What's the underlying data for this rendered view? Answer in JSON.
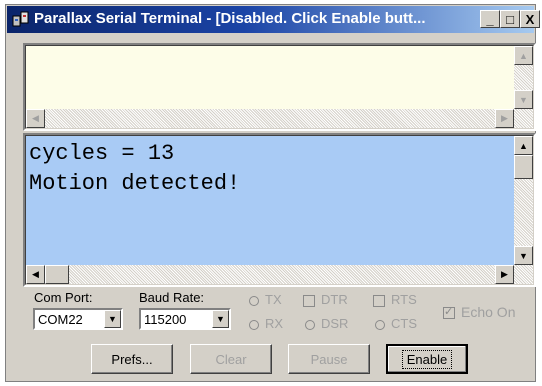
{
  "window": {
    "title": "Parallax Serial Terminal - [Disabled. Click Enable butt...",
    "icon": "serial-terminal-icon",
    "controls": {
      "minimize": "_",
      "maximize": "□",
      "close": "X"
    }
  },
  "transmit_pane": {
    "text": ""
  },
  "receive_pane": {
    "lines": [
      "cycles = 13",
      "Motion detected!"
    ],
    "background": "#a9cbf5"
  },
  "settings": {
    "com_port_label": "Com Port:",
    "com_port_value": "COM22",
    "baud_rate_label": "Baud Rate:",
    "baud_rate_value": "115200",
    "indicators": {
      "tx": "TX",
      "rx": "RX",
      "dtr": "DTR",
      "dsr": "DSR",
      "rts": "RTS",
      "cts": "CTS"
    },
    "echo_on_label": "Echo On",
    "echo_on_checked": true
  },
  "buttons": {
    "prefs": "Prefs...",
    "clear": "Clear",
    "pause": "Pause",
    "enable": "Enable"
  }
}
